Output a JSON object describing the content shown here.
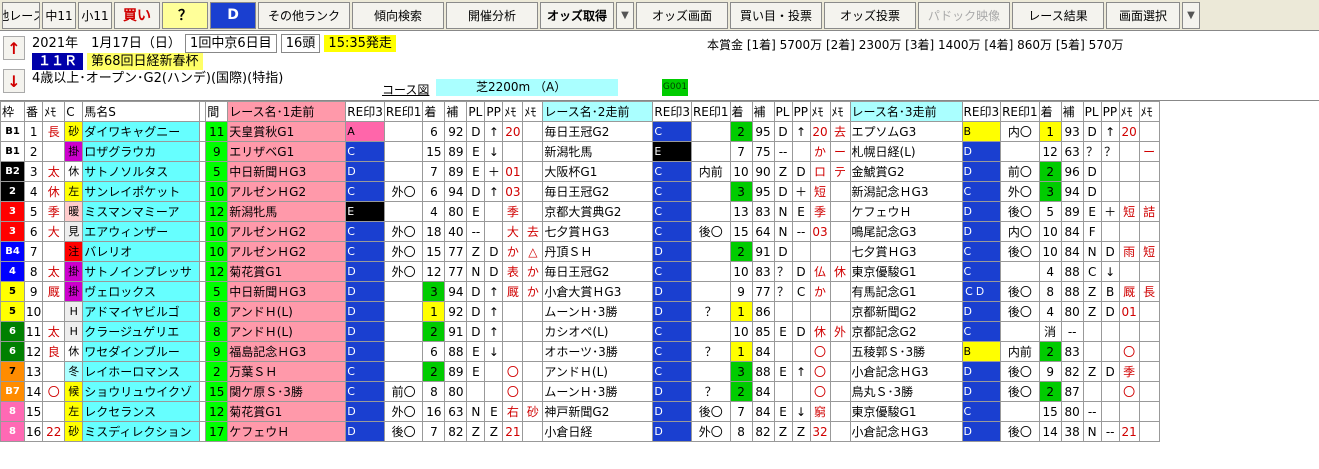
{
  "toolbar": {
    "buttons": [
      {
        "label": "他レース",
        "w": 38,
        "cls": ""
      },
      {
        "label": "中11",
        "w": 34,
        "cls": ""
      },
      {
        "label": "小11",
        "w": 34,
        "cls": ""
      },
      {
        "label": "買い",
        "w": 46,
        "cls": "red"
      },
      {
        "label": "？",
        "w": 46,
        "cls": "q"
      },
      {
        "label": "D",
        "w": 46,
        "cls": "d"
      },
      {
        "label": "その他ランク",
        "w": 92,
        "cls": ""
      },
      {
        "label": "傾向検索",
        "w": 92,
        "cls": ""
      },
      {
        "label": "開催分析",
        "w": 92,
        "cls": ""
      },
      {
        "label": "オッズ取得",
        "w": 74,
        "cls": "bold"
      },
      {
        "label": "▼",
        "w": 18,
        "cls": "arrow"
      },
      {
        "label": "オッズ画面",
        "w": 92,
        "cls": ""
      },
      {
        "label": "買い目・投票",
        "w": 92,
        "cls": ""
      },
      {
        "label": "オッズ投票",
        "w": 92,
        "cls": ""
      },
      {
        "label": "パドック映像",
        "w": 92,
        "cls": "dis"
      },
      {
        "label": "レース結果",
        "w": 92,
        "cls": ""
      },
      {
        "label": "画面選択",
        "w": 74,
        "cls": ""
      },
      {
        "label": "▼",
        "w": 18,
        "cls": "arrow"
      }
    ]
  },
  "info": {
    "date": "2021年　1月17日（日）",
    "meet": "1回中京6日目",
    "heads": "16頭",
    "start": "15:35発走",
    "race_no": "１１Ｒ",
    "race_name": "第68回日経新春杯",
    "cond": "4歳以上･オープン･G2(ハンデ)(国際)(特指)",
    "prize": "本賞金 [1着] 5700万 [2着] 2300万 [3着] 1400万 [4着] 860万 [5着] 570万",
    "course_label": "コース図",
    "course": "芝2200m （A）",
    "code": "G001",
    "up": "↑",
    "down": "↓"
  },
  "headers": [
    "枠",
    "番",
    "ﾒﾓ",
    "C",
    "馬名S",
    "",
    "間",
    "レース名･1走前",
    "RE印3",
    "RE印1",
    "着",
    "補",
    "PL",
    "PP",
    "ﾒﾓ",
    "ﾒﾓ",
    "レース名･2走前",
    "RE印3",
    "RE印1",
    "着",
    "補",
    "PL",
    "PP",
    "ﾒﾓ",
    "ﾒﾓ",
    "レース名･3走前",
    "RE印3",
    "RE印1",
    "着",
    "補",
    "PL",
    "PP",
    "ﾒﾓ",
    "ﾒﾓ"
  ],
  "colors": {
    "w1": "#ffffff",
    "w2": "#000000",
    "w3": "#ff0000",
    "w4": "#0000ff",
    "w5": "#ffff00",
    "w6": "#008000",
    "w7": "#ff8c00",
    "w8": "#ff69b4"
  },
  "rows": [
    {
      "waku": "B1",
      "wc": "#ffffff",
      "wt": "#000",
      "no": "1",
      "memo": "長",
      "c": "砂",
      "ct": "#ffff00",
      "name": "ダイワキャグニー",
      "pop": "11",
      "r1": [
        "天皇賞秋G1",
        "A",
        "",
        "6",
        "92",
        "D",
        "↑",
        "20",
        ""
      ],
      "r2": [
        "毎日王冠G2",
        "C",
        "",
        "2",
        "95",
        "D",
        "↑",
        "20",
        "去"
      ],
      "r3": [
        "エプソムG3",
        "B",
        "内〇",
        "1",
        "93",
        "D",
        "↑",
        "20",
        ""
      ]
    },
    {
      "waku": "B1",
      "wc": "#ffffff",
      "wt": "#000",
      "no": "2",
      "memo": "",
      "c": "掛",
      "ct": "#cc00cc",
      "name": "ロザグラウカ",
      "pop": "9",
      "r1": [
        "エリザベG1",
        "C",
        "",
        "15",
        "89",
        "E",
        "↓",
        "",
        ""
      ],
      "r2": [
        "新潟牝馬",
        "E",
        "",
        "7",
        "75",
        "--",
        "",
        "か",
        "ー"
      ],
      "r3": [
        "札幌日経(L)",
        "D",
        "",
        "12",
        "63",
        "？",
        "？",
        "",
        "ー"
      ]
    },
    {
      "waku": "B2",
      "wc": "#000000",
      "wt": "#fff",
      "no": "3",
      "memo": "太",
      "c": "休",
      "ct": "#ffffff",
      "name": "サトノソルタス",
      "pop": "5",
      "r1": [
        "中日新聞ＨG3",
        "D",
        "",
        "7",
        "89",
        "E",
        "＋",
        "01",
        ""
      ],
      "r2": [
        "大阪杯G1",
        "C",
        "内前",
        "10",
        "90",
        "Z",
        "D",
        "ロ",
        "テ"
      ],
      "r3": [
        "金鯱賞G2",
        "D",
        "前〇",
        "2",
        "96",
        "D",
        "",
        "",
        ""
      ]
    },
    {
      "waku": "2",
      "wc": "#000000",
      "wt": "#fff",
      "no": "4",
      "memo": "休",
      "c": "左",
      "ct": "#ffff00",
      "name": "サンレイポケット",
      "pop": "10",
      "r1": [
        "アルゼンＨG2",
        "C",
        "外〇",
        "6",
        "94",
        "D",
        "↑",
        "03",
        ""
      ],
      "r2": [
        "毎日王冠G2",
        "C",
        "",
        "3",
        "95",
        "D",
        "＋",
        "短",
        ""
      ],
      "r3": [
        "新潟記念ＨG3",
        "C",
        "外〇",
        "3",
        "94",
        "D",
        "",
        "",
        ""
      ]
    },
    {
      "waku": "3",
      "wc": "#ff0000",
      "wt": "#fff",
      "no": "5",
      "memo": "季",
      "c": "暖",
      "ct": "#ffcccc",
      "name": "ミスマンマミーア",
      "pop": "12",
      "r1": [
        "新潟牝馬",
        "E",
        "",
        "4",
        "80",
        "E",
        "",
        "季",
        ""
      ],
      "r2": [
        "京都大賞典G2",
        "C",
        "",
        "13",
        "83",
        "N",
        "E",
        "季",
        ""
      ],
      "r3": [
        "ケフェウＨ",
        "D",
        "後〇",
        "5",
        "89",
        "E",
        "＋",
        "短",
        "詰"
      ]
    },
    {
      "waku": "3",
      "wc": "#ff0000",
      "wt": "#fff",
      "no": "6",
      "memo": "大",
      "c": "見",
      "ct": "#eeeeee",
      "name": "エアウィンザー",
      "pop": "10",
      "r1": [
        "アルゼンＨG2",
        "C",
        "外〇",
        "18",
        "40",
        "--",
        "",
        "大",
        "去"
      ],
      "r2": [
        "七夕賞ＨG3",
        "C",
        "後〇",
        "15",
        "64",
        "N",
        "--",
        "03",
        ""
      ],
      "r3": [
        "鳴尾記念G3",
        "D",
        "内〇",
        "10",
        "84",
        "F",
        "",
        "",
        ""
      ]
    },
    {
      "waku": "B4",
      "wc": "#0000ff",
      "wt": "#fff",
      "no": "7",
      "memo": "",
      "c": "注",
      "ct": "#ff0000",
      "name": "バレリオ",
      "pop": "10",
      "r1": [
        "アルゼンＨG2",
        "C",
        "外〇",
        "15",
        "77",
        "Z",
        "D",
        "か",
        "△"
      ],
      "r2": [
        "丹頂ＳＨ",
        "D",
        "",
        "2",
        "91",
        "D",
        "",
        "",
        ""
      ],
      "r3": [
        "七夕賞ＨG3",
        "C",
        "後〇",
        "10",
        "84",
        "N",
        "D",
        "雨",
        "短"
      ]
    },
    {
      "waku": "4",
      "wc": "#0000ff",
      "wt": "#fff",
      "no": "8",
      "memo": "太",
      "c": "掛",
      "ct": "#cc00cc",
      "name": "サトノインプレッサ",
      "pop": "12",
      "r1": [
        "菊花賞G1",
        "D",
        "外〇",
        "12",
        "77",
        "N",
        "D",
        "表",
        "か"
      ],
      "r2": [
        "毎日王冠G2",
        "C",
        "",
        "10",
        "83",
        "？",
        "D",
        "仏",
        "休"
      ],
      "r3": [
        "東京優駿G1",
        "C",
        "",
        "4",
        "88",
        "C",
        "↓",
        "",
        ""
      ]
    },
    {
      "waku": "5",
      "wc": "#ffff00",
      "wt": "#000",
      "no": "9",
      "memo": "厩",
      "c": "掛",
      "ct": "#cc00cc",
      "name": "ヴェロックス",
      "pop": "5",
      "r1": [
        "中日新聞ＨG3",
        "D",
        "",
        "3",
        "94",
        "D",
        "↑",
        "厩",
        "か"
      ],
      "r2": [
        "小倉大賞ＨG3",
        "D",
        "",
        "9",
        "77",
        "？",
        "C",
        "か",
        ""
      ],
      "r3": [
        "有馬記念G1",
        "ＣＤ",
        "後〇",
        "8",
        "88",
        "Z",
        "B",
        "厩",
        "長"
      ]
    },
    {
      "waku": "5",
      "wc": "#ffff00",
      "wt": "#000",
      "no": "10",
      "memo": "",
      "c": "H",
      "ct": "#eeeeee",
      "name": "アドマイヤビルゴ",
      "pop": "8",
      "r1": [
        "アンドＨ(L)",
        "D",
        "",
        "1",
        "92",
        "D",
        "↑",
        "",
        ""
      ],
      "r2": [
        "ムーンＨ･3勝",
        "D",
        "？",
        "1",
        "86",
        "",
        "",
        "",
        ""
      ],
      "r3": [
        "京都新聞G2",
        "D",
        "後〇",
        "4",
        "80",
        "Z",
        "D",
        "01",
        ""
      ]
    },
    {
      "waku": "6",
      "wc": "#008000",
      "wt": "#fff",
      "no": "11",
      "memo": "太",
      "c": "H",
      "ct": "#eeeeee",
      "name": "クラージュゲリエ",
      "pop": "8",
      "r1": [
        "アンドＨ(L)",
        "D",
        "",
        "2",
        "91",
        "D",
        "↑",
        "",
        ""
      ],
      "r2": [
        "カシオペ(L)",
        "C",
        "",
        "10",
        "85",
        "E",
        "D",
        "休",
        "外"
      ],
      "r3": [
        "京都記念G2",
        "C",
        "",
        "消",
        "--",
        "",
        "",
        "",
        ""
      ]
    },
    {
      "waku": "6",
      "wc": "#008000",
      "wt": "#fff",
      "no": "12",
      "memo": "良",
      "c": "休",
      "ct": "#ffffff",
      "name": "ワセダインブルー",
      "pop": "9",
      "r1": [
        "福島記念ＨG3",
        "D",
        "",
        "6",
        "88",
        "E",
        "↓",
        "",
        ""
      ],
      "r2": [
        "オホーツ･3勝",
        "C",
        "？",
        "1",
        "84",
        "",
        "",
        "〇",
        ""
      ],
      "r3": [
        "五稜郭Ｓ･3勝",
        "B",
        "内前",
        "2",
        "83",
        "",
        "",
        "〇",
        ""
      ]
    },
    {
      "waku": "7",
      "wc": "#ff8c00",
      "wt": "#000",
      "no": "13",
      "memo": "",
      "c": "冬",
      "ct": "#aaffff",
      "name": "レイホーロマンス",
      "pop": "2",
      "r1": [
        "万葉ＳＨ",
        "C",
        "",
        "2",
        "89",
        "E",
        "",
        "〇",
        ""
      ],
      "r2": [
        "アンドＨ(L)",
        "C",
        "",
        "3",
        "88",
        "E",
        "↑",
        "〇",
        ""
      ],
      "r3": [
        "小倉記念ＨG3",
        "D",
        "後〇",
        "9",
        "82",
        "Z",
        "D",
        "季",
        ""
      ]
    },
    {
      "waku": "B7",
      "wc": "#ff8c00",
      "wt": "#fff",
      "no": "14",
      "memo": "〇",
      "c": "候",
      "ct": "#ffff00",
      "name": "ショウリュウイクゾ",
      "pop": "15",
      "r1": [
        "関ケ原Ｓ･3勝",
        "C",
        "前〇",
        "8",
        "80",
        "",
        "",
        "〇",
        ""
      ],
      "r2": [
        "ムーンＨ･3勝",
        "D",
        "？",
        "2",
        "84",
        "",
        "",
        "〇",
        ""
      ],
      "r3": [
        "鳥丸Ｓ･3勝",
        "D",
        "後〇",
        "2",
        "87",
        "",
        "",
        "〇",
        ""
      ]
    },
    {
      "waku": "8",
      "wc": "#ff69b4",
      "wt": "#fff",
      "no": "15",
      "memo": "",
      "c": "左",
      "ct": "#ffff00",
      "name": "レクセランス",
      "pop": "12",
      "r1": [
        "菊花賞G1",
        "D",
        "外〇",
        "16",
        "63",
        "N",
        "E",
        "右",
        "砂"
      ],
      "r2": [
        "神戸新聞G2",
        "D",
        "後〇",
        "7",
        "84",
        "E",
        "↓",
        "窮",
        ""
      ],
      "r3": [
        "東京優駿G1",
        "C",
        "",
        "15",
        "80",
        "--",
        "",
        "",
        ""
      ]
    },
    {
      "waku": "8",
      "wc": "#ff69b4",
      "wt": "#fff",
      "no": "16",
      "memo": "22",
      "c": "砂",
      "ct": "#ffff00",
      "name": "ミスディレクション",
      "pop": "17",
      "r1": [
        "ケフェウＨ",
        "D",
        "後〇",
        "7",
        "82",
        "Z",
        "Z",
        "21",
        ""
      ],
      "r2": [
        "小倉日経",
        "D",
        "外〇",
        "8",
        "82",
        "Z",
        "Z",
        "32",
        ""
      ],
      "r3": [
        "小倉記念ＨG3",
        "D",
        "後〇",
        "14",
        "38",
        "N",
        "--",
        "21",
        ""
      ]
    }
  ]
}
